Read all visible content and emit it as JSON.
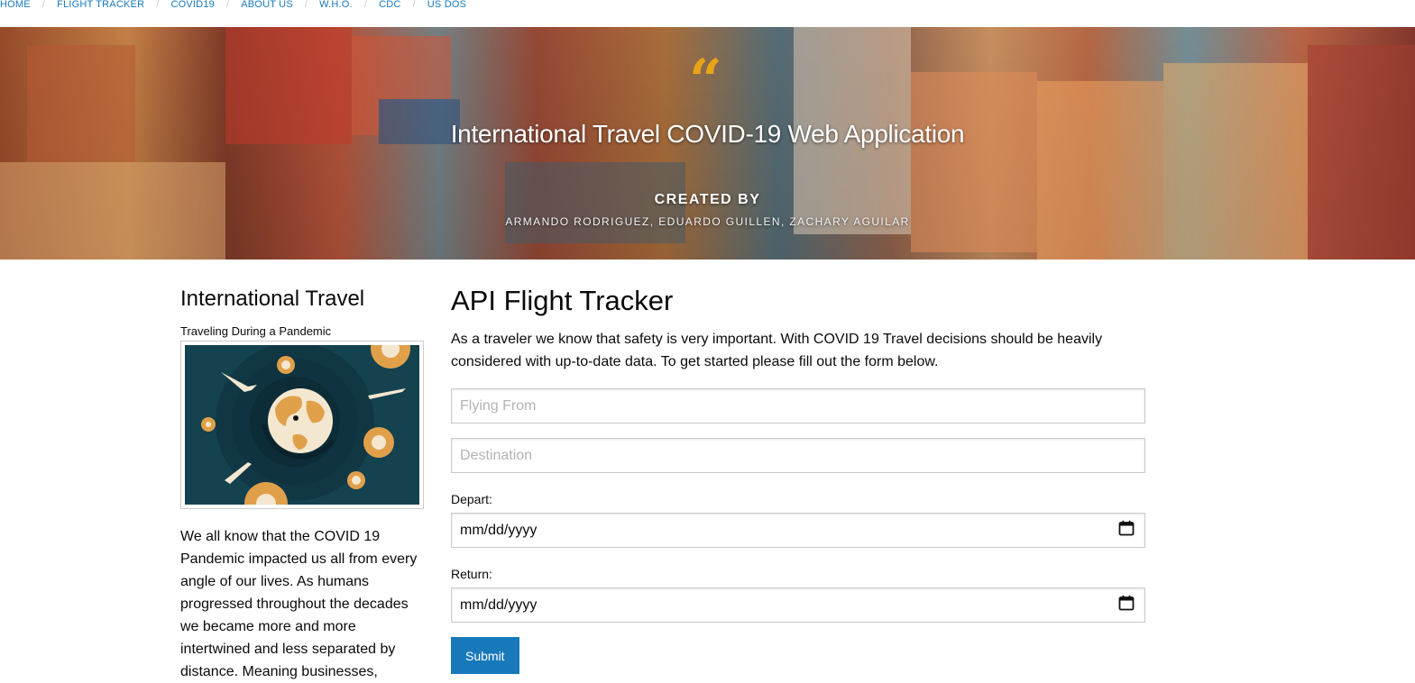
{
  "breadcrumb": {
    "items": [
      "HOME",
      "FLIGHT TRACKER",
      "COVID19",
      "ABOUT US",
      "W.H.O.",
      "CDC",
      "US DOS"
    ],
    "separator": "/"
  },
  "hero": {
    "quote_glyph": "“",
    "title": "International Travel COVID-19 Web Application",
    "created_label": "CREATED BY",
    "authors": "ARMANDO RODRIGUEZ, EDUARDO GUILLEN, ZACHARY AGUILAR"
  },
  "sidebar": {
    "title": "International Travel",
    "subtitle": "Traveling During a Pandemic",
    "image_icon": "globe-virus-airplanes-illustration",
    "text": "We all know that the COVID 19 Pandemic impacted us all from every angle of our lives. As humans progressed throughout the decades we became more and more intertwined and less separated by distance. Meaning businesses,"
  },
  "main": {
    "title": "API Flight Tracker",
    "intro": "As a traveler we know that safety is very important. With COVID 19 Travel decisions should be heavily considered with up-to-date data. To get started please fill out the form below.",
    "from_placeholder": "Flying From",
    "destination_placeholder": "Destination",
    "depart_label": "Depart:",
    "depart_value": "mm/dd/yyyy",
    "return_label": "Return:",
    "return_value": "mm/dd/yyyy",
    "submit_label": "Submit"
  },
  "colors": {
    "link": "#1779ba",
    "quote": "#e8a317",
    "button": "#1779ba",
    "illustration_bg": "#15424f",
    "virus": "#e0a04a"
  }
}
